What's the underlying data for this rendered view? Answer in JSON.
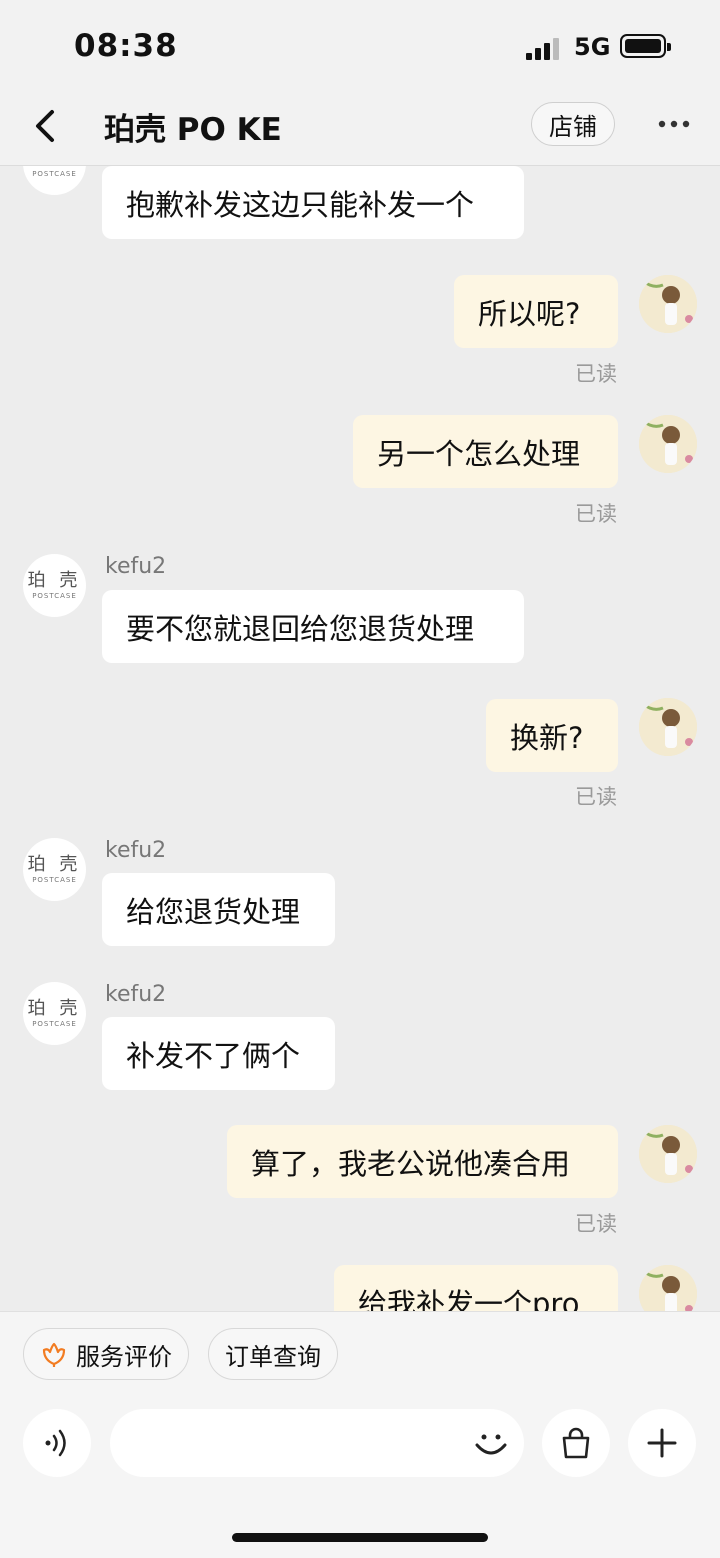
{
  "status_bar": {
    "time": "08:38",
    "network": "5G"
  },
  "header": {
    "title": "珀壳 PO KE",
    "shop_button": "店铺"
  },
  "shop_avatar": {
    "cn": "珀 壳",
    "en": "POSTCASE"
  },
  "messages": [
    {
      "text": "抱歉补发这边只能补发一个"
    },
    {
      "text": "所以呢?",
      "status": "已读"
    },
    {
      "text": "另一个怎么处理",
      "status": "已读"
    },
    {
      "sender": "kefu2",
      "text": "要不您就退回给您退货处理"
    },
    {
      "text": "换新?",
      "status": "已读"
    },
    {
      "sender": "kefu2",
      "text": "给您退货处理"
    },
    {
      "sender": "kefu2",
      "text": "补发不了俩个"
    },
    {
      "text": "算了，我老公说他凑合用",
      "status": "已读"
    },
    {
      "text": "给我补发一个pro"
    }
  ],
  "quick_actions": [
    {
      "label": "服务评价",
      "icon": "flower-icon"
    },
    {
      "label": "订单查询"
    }
  ],
  "input_bar": {
    "icons": [
      "voice-icon",
      "emoji-icon",
      "shopping-bag-icon",
      "plus-icon"
    ]
  },
  "colors": {
    "incoming_bubble": "#ffffff",
    "outgoing_bubble": "#fdf6e3",
    "accent": "#f27c22"
  }
}
